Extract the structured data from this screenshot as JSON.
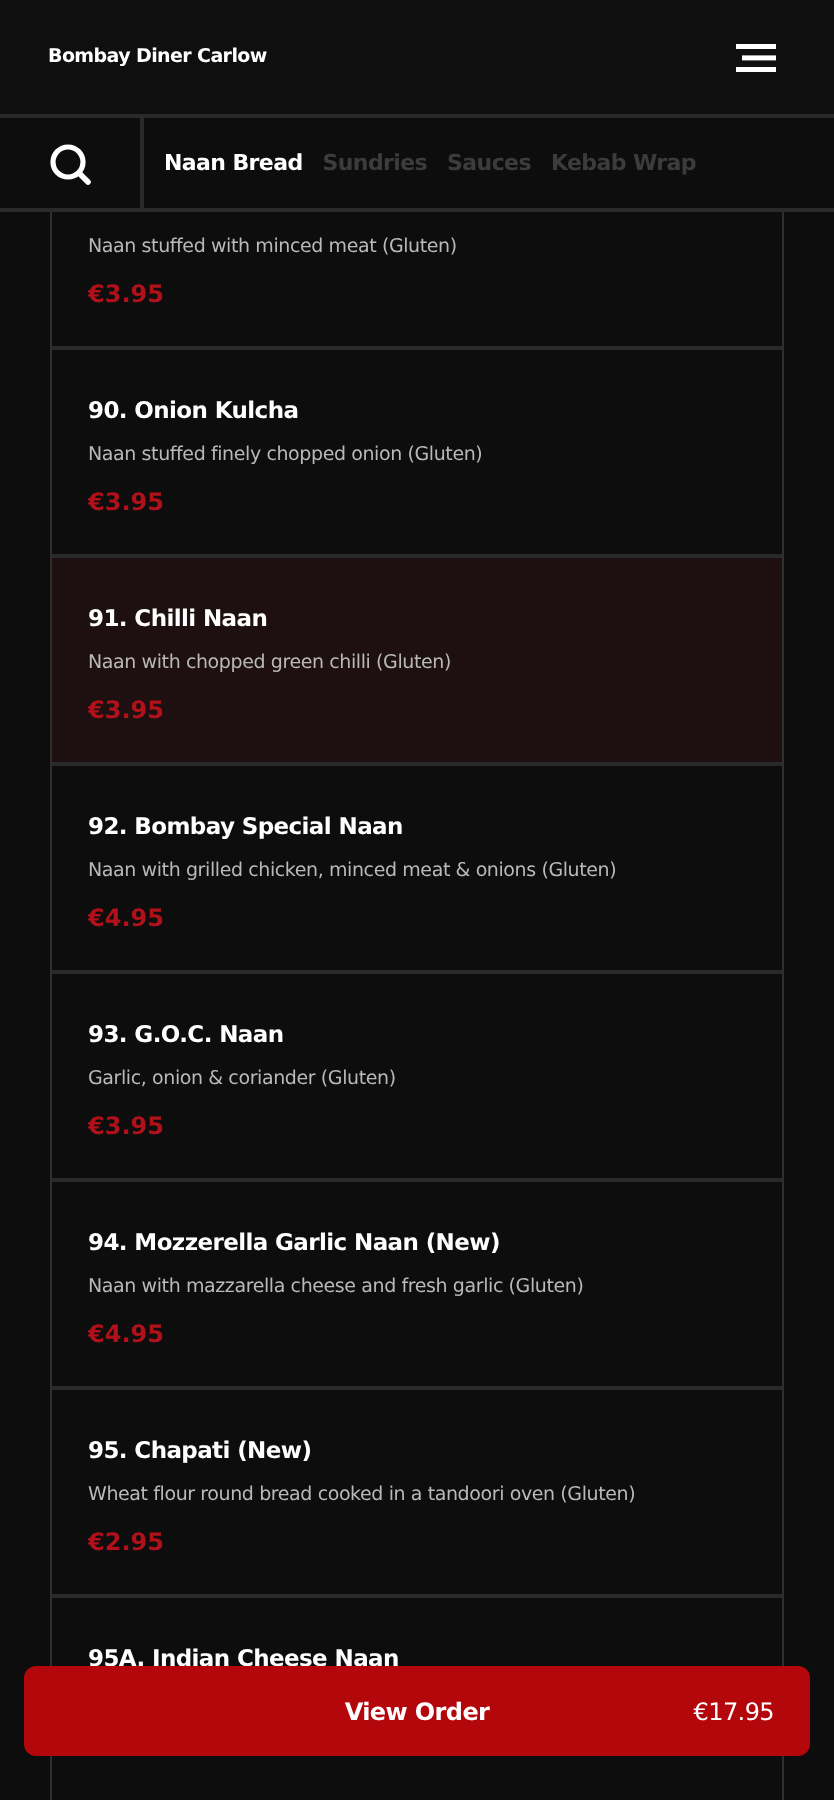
{
  "header": {
    "title": "Bombay Diner Carlow"
  },
  "tabs": [
    {
      "label": "Naan Bread",
      "selected": true
    },
    {
      "label": "Sundries",
      "selected": false
    },
    {
      "label": "Sauces",
      "selected": false
    },
    {
      "label": "Kebab Wrap",
      "selected": false
    }
  ],
  "items": [
    {
      "description": "Naan stuffed with minced meat (Gluten)",
      "price": "€3.95",
      "highlighted": false
    },
    {
      "name": "90. Onion Kulcha",
      "description": "Naan stuffed finely chopped onion (Gluten)",
      "price": "€3.95",
      "highlighted": false
    },
    {
      "name": "91. Chilli Naan",
      "description": "Naan with chopped green chilli (Gluten)",
      "price": "€3.95",
      "highlighted": true
    },
    {
      "name": "92. Bombay Special Naan",
      "description": "Naan with grilled chicken, minced meat & onions (Gluten)",
      "price": "€4.95",
      "highlighted": false
    },
    {
      "name": "93. G.O.C. Naan",
      "description": "Garlic, onion & coriander (Gluten)",
      "price": "€3.95",
      "highlighted": false
    },
    {
      "name": "94. Mozzerella Garlic Naan (New)",
      "description": "Naan with mazzarella cheese and fresh garlic (Gluten)",
      "price": "€4.95",
      "highlighted": false
    },
    {
      "name": "95. Chapati (New)",
      "description": "Wheat flour round bread cooked in a tandoori oven (Gluten)",
      "price": "€2.95",
      "highlighted": false
    },
    {
      "name": "95A. Indian Cheese Naan",
      "highlighted": false
    }
  ],
  "order_button": {
    "label": "View Order",
    "total": "€17.95"
  }
}
